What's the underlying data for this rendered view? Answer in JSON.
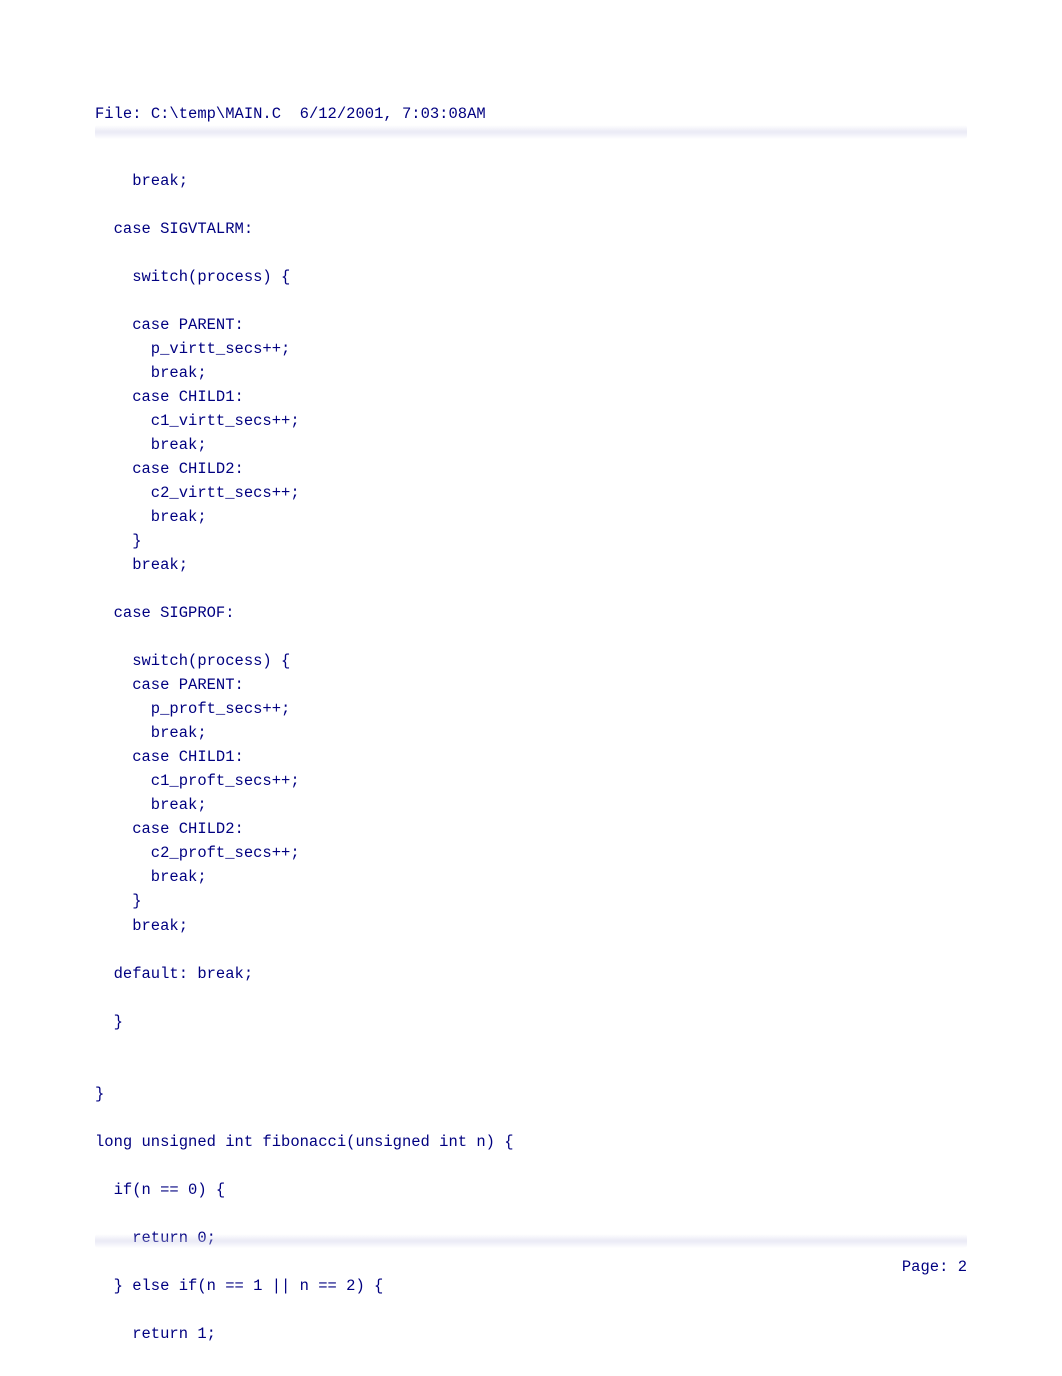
{
  "header": {
    "file_label": "File: ",
    "file_path": "C:\\temp\\MAIN.C",
    "timestamp": "6/12/2001, 7:03:08AM"
  },
  "code": {
    "lines": [
      "",
      "    break;",
      "",
      "  case SIGVTALRM:",
      "",
      "    switch(process) {",
      "",
      "    case PARENT:",
      "      p_virtt_secs++;",
      "      break;",
      "    case CHILD1:",
      "      c1_virtt_secs++;",
      "      break;",
      "    case CHILD2:",
      "      c2_virtt_secs++;",
      "      break;",
      "    }",
      "    break;",
      "",
      "  case SIGPROF:",
      "",
      "    switch(process) {",
      "    case PARENT:",
      "      p_proft_secs++;",
      "      break;",
      "    case CHILD1:",
      "      c1_proft_secs++;",
      "      break;",
      "    case CHILD2:",
      "      c2_proft_secs++;",
      "      break;",
      "    }",
      "    break;",
      "",
      "  default: break;",
      "",
      "  }",
      "",
      "",
      "}",
      "",
      "long unsigned int fibonacci(unsigned int n) {",
      "",
      "  if(n == 0) {",
      "",
      "    return 0;",
      "",
      "  } else if(n == 1 || n == 2) {",
      "",
      "    return 1;"
    ]
  },
  "footer": {
    "page_label": "Page: ",
    "page_number": "2"
  }
}
